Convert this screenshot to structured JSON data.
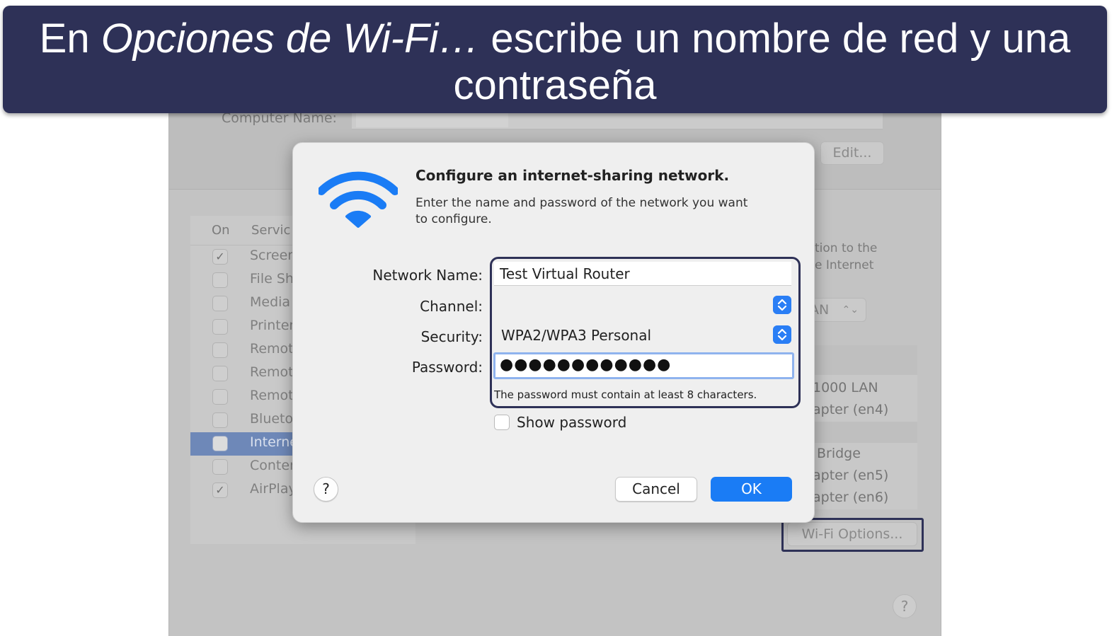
{
  "banner": {
    "line1_prefix": "En ",
    "line1_italic": "Opciones de Wi-Fi…",
    "line1_suffix": " escribe un nombre de red y una",
    "line2": "contraseña"
  },
  "background_window": {
    "computer_name_label": "Computer Name:",
    "edit_button": "Edit...",
    "services_header": {
      "on": "On",
      "service": "Servic"
    },
    "services": [
      {
        "name": "Screer",
        "checked": true,
        "selected": false
      },
      {
        "name": "File Sh",
        "checked": false,
        "selected": false
      },
      {
        "name": "Media",
        "checked": false,
        "selected": false
      },
      {
        "name": "Printer",
        "checked": false,
        "selected": false
      },
      {
        "name": "Remot",
        "checked": false,
        "selected": false
      },
      {
        "name": "Remot",
        "checked": false,
        "selected": false
      },
      {
        "name": "Remot",
        "checked": false,
        "selected": false
      },
      {
        "name": "Blueto",
        "checked": false,
        "selected": false
      },
      {
        "name": "Interne",
        "checked": false,
        "selected": true
      },
      {
        "name": "Conter",
        "checked": false,
        "selected": false
      },
      {
        "name": "AirPlay",
        "checked": true,
        "selected": false
      }
    ],
    "right_text_line1": "tion to the",
    "right_text_line2": "e Internet",
    "share_from_value": "AN",
    "ports": [
      "1000 LAN",
      "apter (en4)",
      "Bridge",
      "apter (en5)",
      "apter (en6)"
    ],
    "wifi_options_button": "Wi-Fi Options...",
    "help_button": "?"
  },
  "dialog": {
    "title": "Configure an internet-sharing network.",
    "description": "Enter the name and password of the network you want to configure.",
    "icon": "wifi-icon",
    "network_name_label": "Network Name:",
    "network_name_value": "Test Virtual Router",
    "channel_label": "Channel:",
    "channel_value": "",
    "security_label": "Security:",
    "security_value": "WPA2/WPA3 Personal",
    "password_label": "Password:",
    "password_value": "●●●●●●●●●●●●",
    "password_hint": "The password must contain at least 8 characters.",
    "show_password_label": "Show password",
    "show_password_checked": false,
    "help_button": "?",
    "cancel_button": "Cancel",
    "ok_button": "OK"
  },
  "colors": {
    "banner_bg": "#2e3157",
    "accent_blue": "#1a7cf5",
    "wifi_icon": "#1a7cf5"
  }
}
